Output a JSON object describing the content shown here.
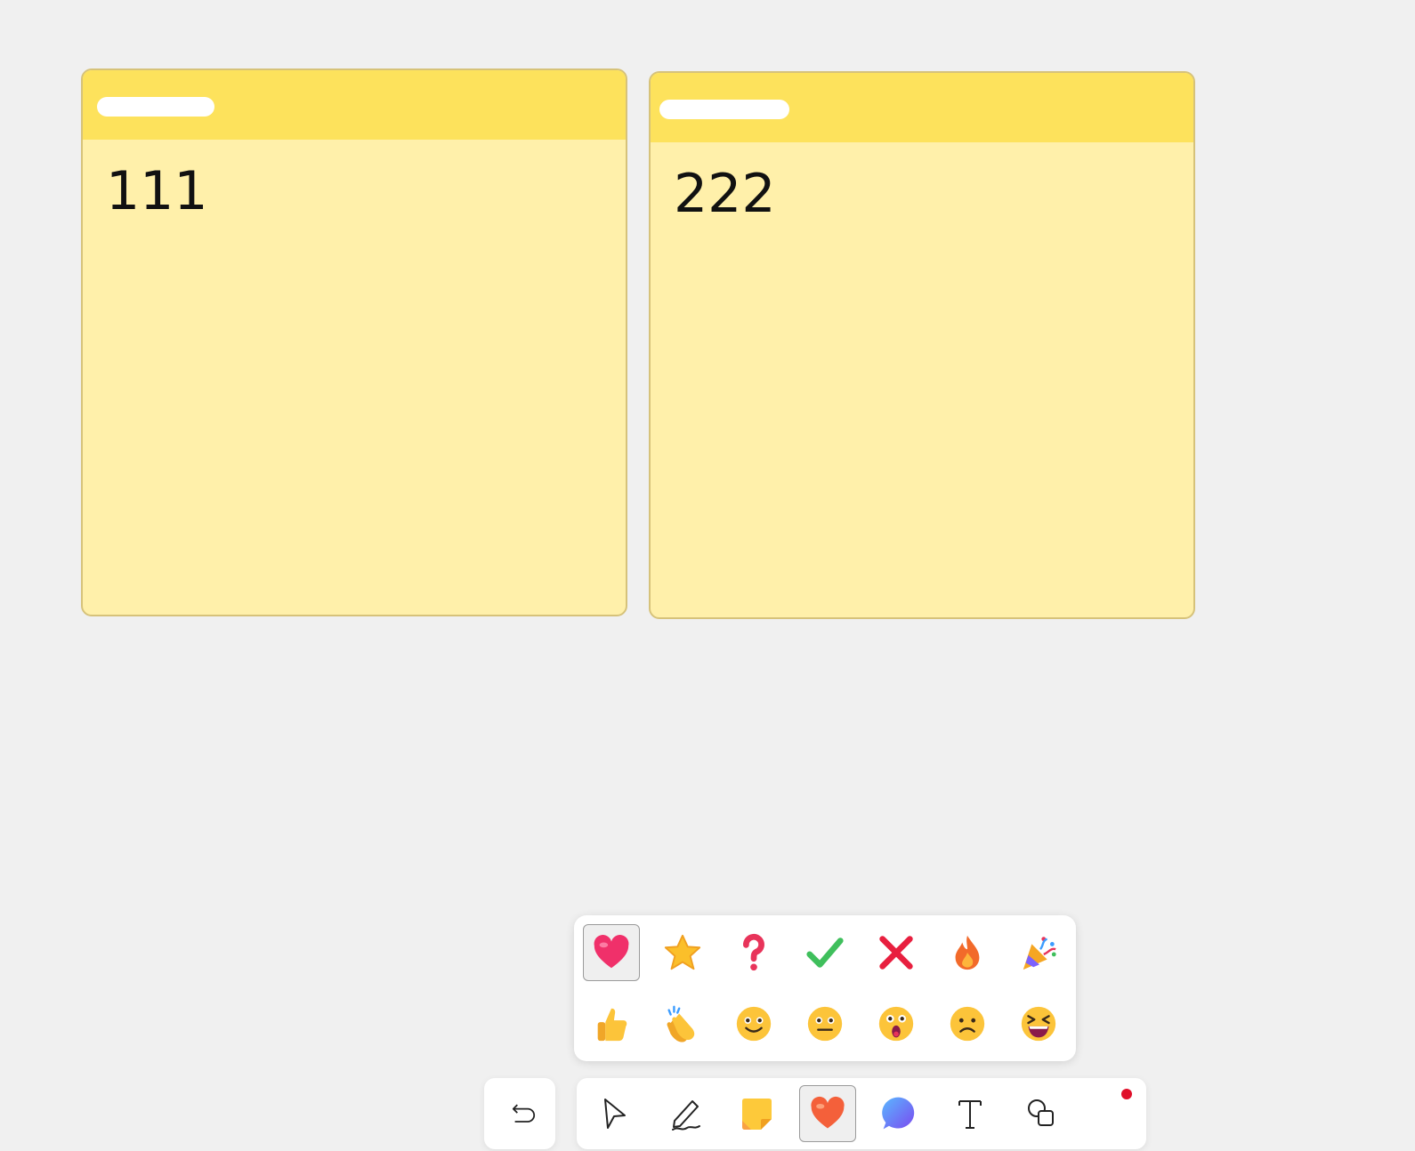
{
  "notes": [
    {
      "text": "111"
    },
    {
      "text": "222"
    }
  ],
  "emoji_palette": {
    "rows": [
      [
        "heart-icon",
        "star-icon",
        "question-icon",
        "check-icon",
        "cross-icon",
        "fire-icon",
        "party-popper-icon"
      ],
      [
        "thumbs-up-icon",
        "clapping-hands-icon",
        "smiling-face-icon",
        "neutral-face-icon",
        "astonished-face-icon",
        "frowning-face-icon",
        "laughing-face-icon"
      ]
    ],
    "selected": "heart-icon"
  },
  "toolbar": {
    "tools": [
      "select-arrow-icon",
      "pen-icon",
      "sticky-note-icon",
      "reaction-heart-icon",
      "chat-bubble-icon",
      "text-icon",
      "shapes-icon"
    ],
    "active": "reaction-heart-icon"
  },
  "colors": {
    "note_header": "#fde25c",
    "note_body": "#fff0aa",
    "background": "#f0f0f0",
    "notification_dot": "#e0102a"
  }
}
